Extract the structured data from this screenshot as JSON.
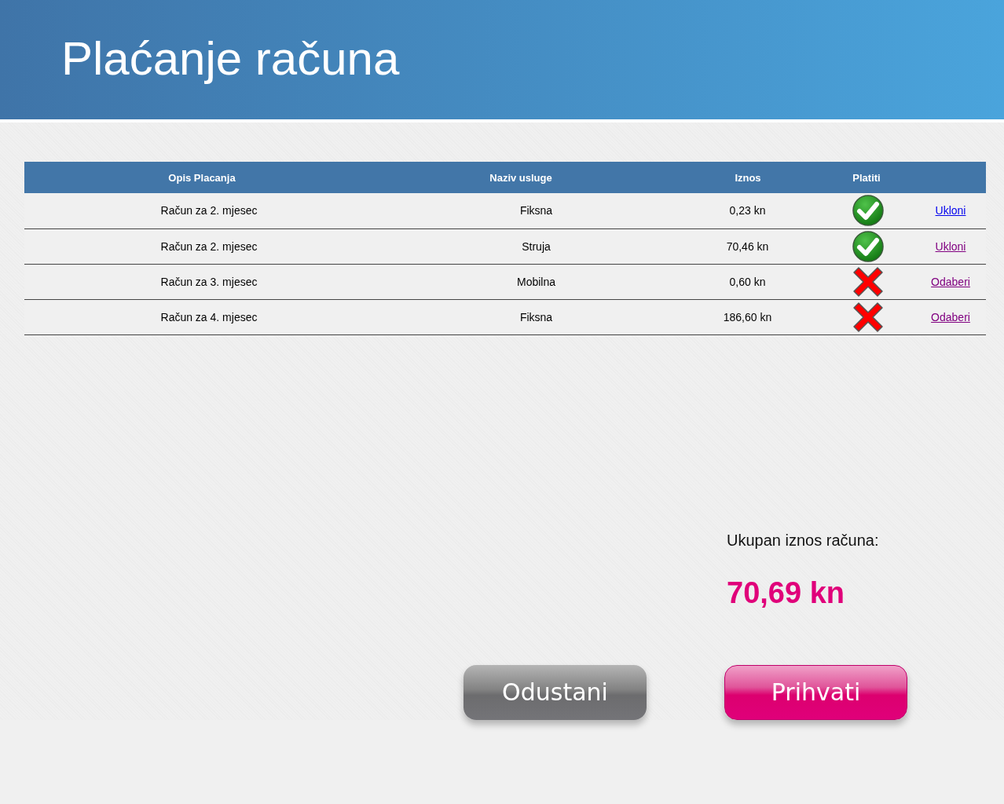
{
  "header": {
    "title": "Plaćanje računa"
  },
  "table": {
    "columns": [
      "Opis Placanja",
      "Naziv usluge",
      "Iznos",
      "Platiti"
    ],
    "rows": [
      {
        "description": "Račun za 2. mjesec",
        "service": "Fiksna",
        "amount": "0,23 kn",
        "pay": true,
        "action": {
          "label": "Ukloni",
          "visited": false
        }
      },
      {
        "description": "Račun za 2. mjesec",
        "service": "Struja",
        "amount": "70,46 kn",
        "pay": true,
        "action": {
          "label": "Ukloni",
          "visited": true
        }
      },
      {
        "description": "Račun za 3. mjesec",
        "service": "Mobilna",
        "amount": "0,60 kn",
        "pay": false,
        "action": {
          "label": "Odaberi",
          "visited": true
        }
      },
      {
        "description": "Račun za 4. mjesec",
        "service": "Fiksna",
        "amount": "186,60 kn",
        "pay": false,
        "action": {
          "label": "Odaberi",
          "visited": true
        }
      }
    ]
  },
  "total": {
    "label": "Ukupan iznos računa:",
    "amount": "70,69 kn"
  },
  "buttons": [
    {
      "label": "Odustani",
      "kind": "cancel"
    },
    {
      "label": "Prihvati",
      "kind": "accept"
    }
  ]
}
